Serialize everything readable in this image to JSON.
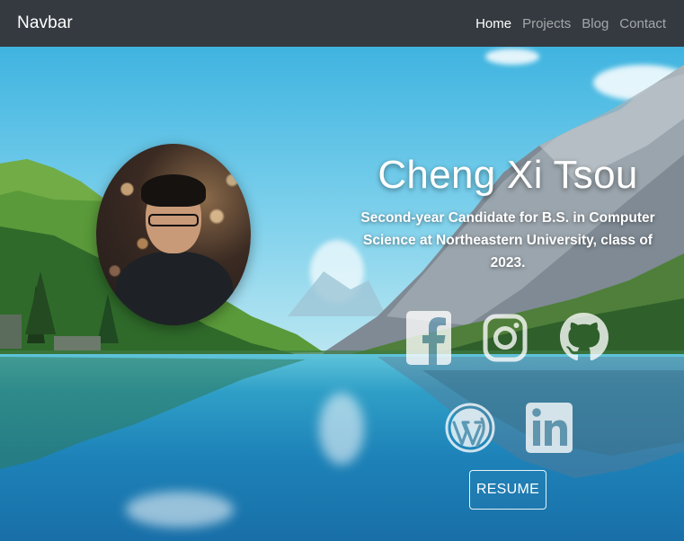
{
  "navbar": {
    "brand": "Navbar",
    "links": [
      {
        "label": "Home",
        "active": true
      },
      {
        "label": "Projects",
        "active": false
      },
      {
        "label": "Blog",
        "active": false
      },
      {
        "label": "Contact",
        "active": false
      }
    ]
  },
  "hero": {
    "name": "Cheng Xi Tsou",
    "tagline": "Second-year Candidate for B.S. in Computer Science at Northeastern University, class of 2023.",
    "resume_label": "RESUME",
    "social_icons": [
      "facebook-icon",
      "instagram-icon",
      "github-icon",
      "wordpress-icon",
      "linkedin-icon"
    ]
  },
  "colors": {
    "navbar_bg": "#343a40",
    "nav_active": "#ffffff",
    "nav_inactive": "rgba(255,255,255,0.55)"
  }
}
